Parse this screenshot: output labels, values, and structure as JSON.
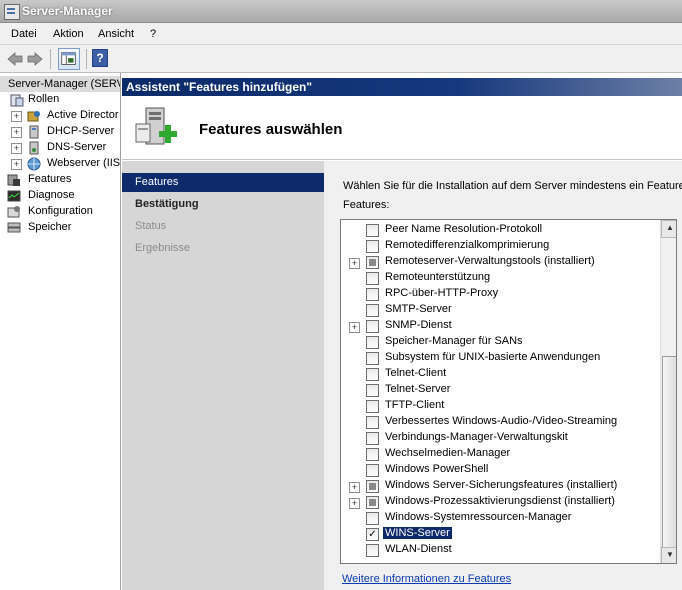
{
  "window": {
    "title": "Server-Manager"
  },
  "menu": [
    "Datei",
    "Aktion",
    "Ansicht",
    "?"
  ],
  "toolbar": {
    "help_label": "?"
  },
  "tree": {
    "root": "Server-Manager (SERV",
    "items": [
      {
        "label": "Rollen",
        "indent": 0,
        "expander": false,
        "icon": "roles-icon"
      },
      {
        "label": "Active Director",
        "indent": 1,
        "expander": true,
        "icon": "active-directory-icon"
      },
      {
        "label": "DHCP-Server",
        "indent": 1,
        "expander": true,
        "icon": "dhcp-icon"
      },
      {
        "label": "DNS-Server",
        "indent": 1,
        "expander": true,
        "icon": "dns-icon"
      },
      {
        "label": "Webserver (IIS",
        "indent": 1,
        "expander": true,
        "icon": "webserver-icon"
      },
      {
        "label": "Features",
        "indent": 0,
        "expander": false,
        "icon": "features-icon"
      },
      {
        "label": "Diagnose",
        "indent": 0,
        "expander": false,
        "icon": "diagnose-icon"
      },
      {
        "label": "Konfiguration",
        "indent": 0,
        "expander": false,
        "icon": "configuration-icon"
      },
      {
        "label": "Speicher",
        "indent": 0,
        "expander": false,
        "icon": "storage-icon"
      }
    ]
  },
  "wizard": {
    "title": "Assistent \"Features hinzufügen\"",
    "heading": "Features auswählen",
    "nav": [
      {
        "label": "Features",
        "state": "active"
      },
      {
        "label": "Bestätigung",
        "state": "bold"
      },
      {
        "label": "Status",
        "state": "dim"
      },
      {
        "label": "Ergebnisse",
        "state": "dim"
      }
    ],
    "instruction": "Wählen Sie für die Installation auf dem Server mindestens ein Feature",
    "features_label": "Features:",
    "more_info_link": "Weitere Informationen zu Features",
    "features": [
      {
        "label": "Peer Name Resolution-Protokoll",
        "state": "unchecked",
        "expander": false
      },
      {
        "label": "Remotedifferenzialkomprimierung",
        "state": "unchecked",
        "expander": false
      },
      {
        "label": "Remoteserver-Verwaltungstools  (installiert)",
        "state": "partial",
        "expander": true
      },
      {
        "label": "Remoteunterstützung",
        "state": "unchecked",
        "expander": false
      },
      {
        "label": "RPC-über-HTTP-Proxy",
        "state": "unchecked",
        "expander": false
      },
      {
        "label": "SMTP-Server",
        "state": "unchecked",
        "expander": false
      },
      {
        "label": "SNMP-Dienst",
        "state": "unchecked",
        "expander": true
      },
      {
        "label": "Speicher-Manager für SANs",
        "state": "unchecked",
        "expander": false
      },
      {
        "label": "Subsystem für UNIX-basierte Anwendungen",
        "state": "unchecked",
        "expander": false
      },
      {
        "label": "Telnet-Client",
        "state": "unchecked",
        "expander": false
      },
      {
        "label": "Telnet-Server",
        "state": "unchecked",
        "expander": false
      },
      {
        "label": "TFTP-Client",
        "state": "unchecked",
        "expander": false
      },
      {
        "label": "Verbessertes Windows-Audio-/Video-Streaming",
        "state": "unchecked",
        "expander": false
      },
      {
        "label": "Verbindungs-Manager-Verwaltungskit",
        "state": "unchecked",
        "expander": false
      },
      {
        "label": "Wechselmedien-Manager",
        "state": "unchecked",
        "expander": false
      },
      {
        "label": "Windows PowerShell",
        "state": "unchecked",
        "expander": false
      },
      {
        "label": "Windows Server-Sicherungsfeatures  (installiert)",
        "state": "partial",
        "expander": true
      },
      {
        "label": "Windows-Prozessaktivierungsdienst  (installiert)",
        "state": "partial",
        "expander": true
      },
      {
        "label": "Windows-Systemressourcen-Manager",
        "state": "unchecked",
        "expander": false
      },
      {
        "label": "WINS-Server",
        "state": "checked",
        "expander": false,
        "selected": true
      },
      {
        "label": "WLAN-Dienst",
        "state": "unchecked",
        "expander": false
      }
    ]
  }
}
